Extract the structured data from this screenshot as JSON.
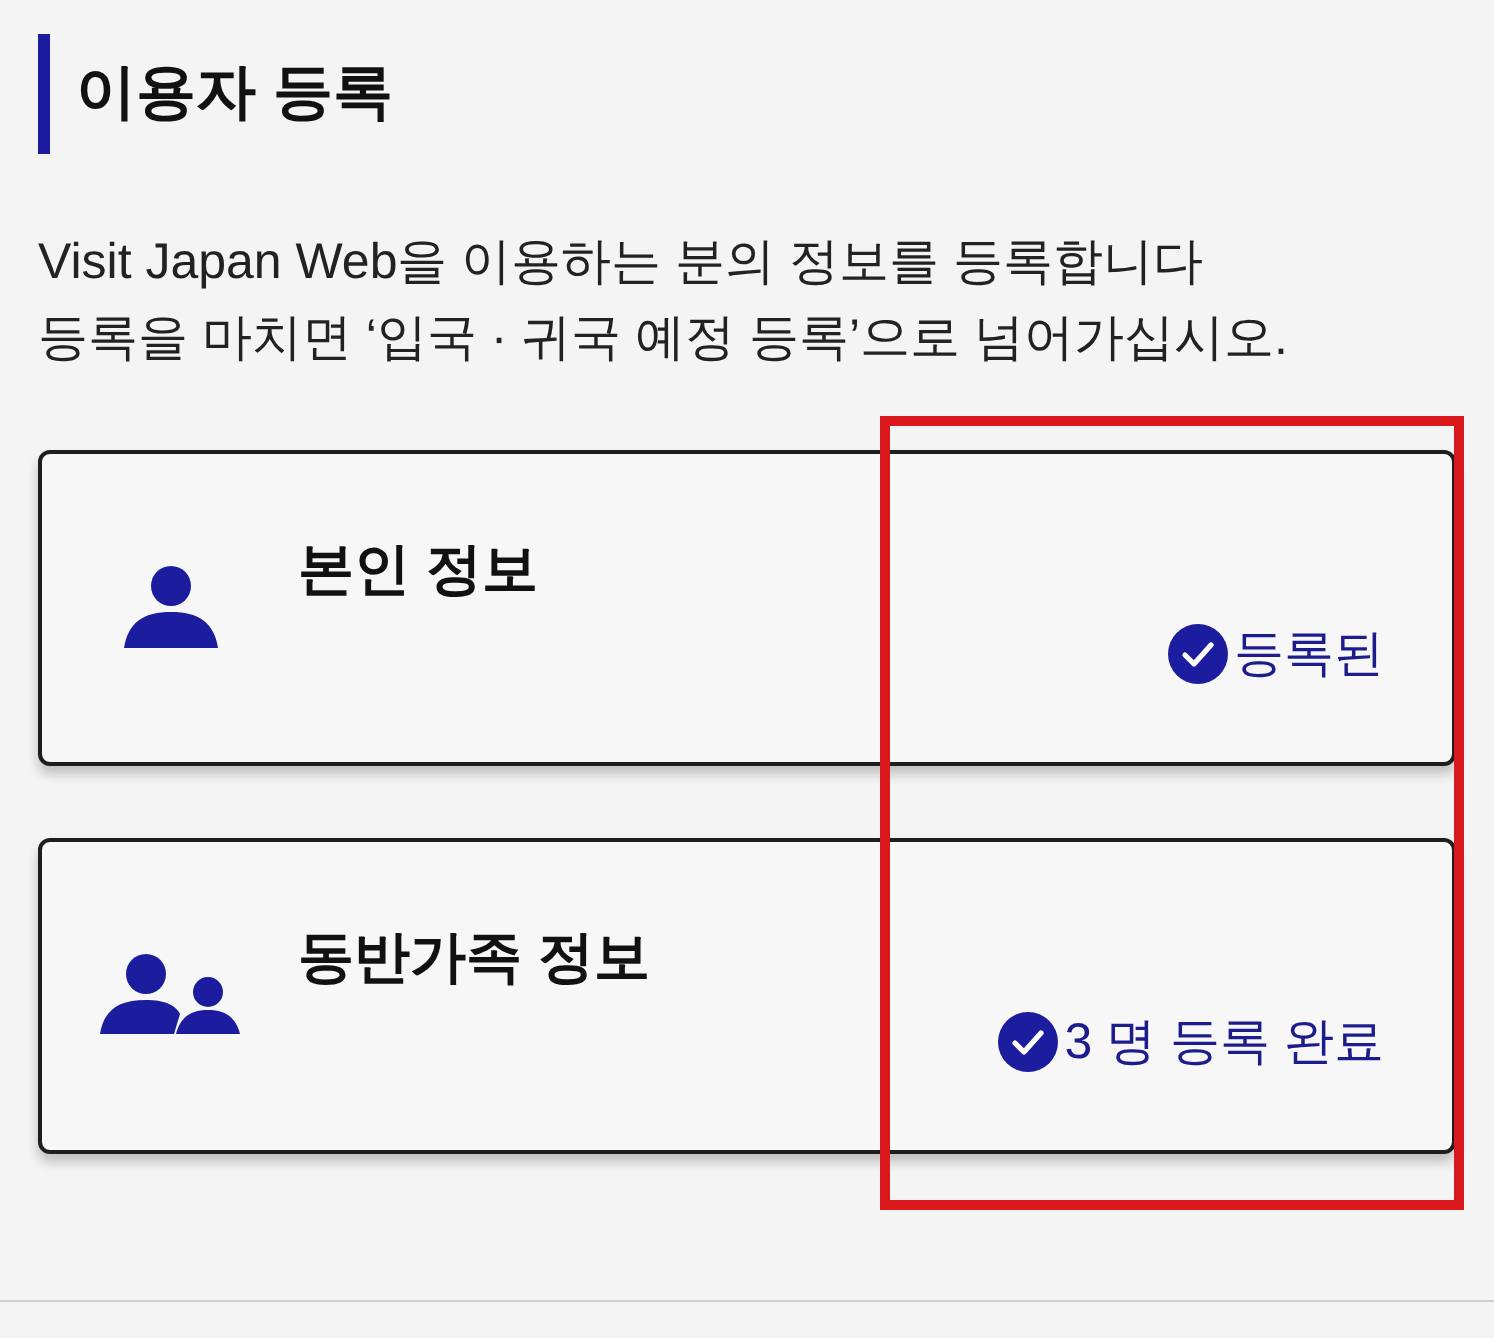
{
  "section": {
    "title": "이용자 등록"
  },
  "description": [
    "Visit Japan Web을 이용하는 분의 정보를 등록합니다",
    "등록을 마치면 ‘입국 · 귀국 예정 등록’으로 넘어가십시오."
  ],
  "cards": [
    {
      "kind": "single",
      "title": "본인 정보",
      "status": {
        "text": "등록된",
        "completed": true
      }
    },
    {
      "kind": "group",
      "title": "동반가족 정보",
      "status": {
        "text": "3 명 등록 완료",
        "completed": true
      }
    }
  ]
}
